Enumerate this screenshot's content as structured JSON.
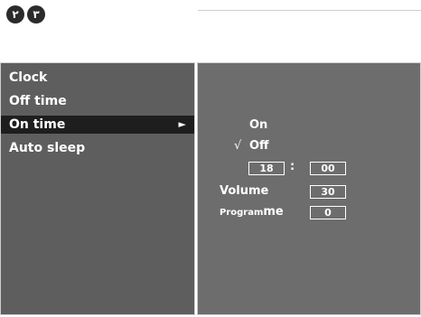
{
  "step_badges": [
    "٢",
    "٣"
  ],
  "left_menu": {
    "items": [
      {
        "label": "Clock"
      },
      {
        "label": "Off time"
      },
      {
        "label": "On time",
        "arrow": "►"
      },
      {
        "label": "Auto sleep"
      }
    ],
    "selected_index": 2
  },
  "right_panel": {
    "options": {
      "on_label": "On",
      "off_label": "Off",
      "checkmark": "√"
    },
    "time": {
      "hour": "18",
      "separator": ":",
      "minute": "00"
    },
    "volume": {
      "label": "Volume",
      "value": "30"
    },
    "programme": {
      "label_part1": "Program",
      "label_part2": "me",
      "value": "0"
    }
  }
}
